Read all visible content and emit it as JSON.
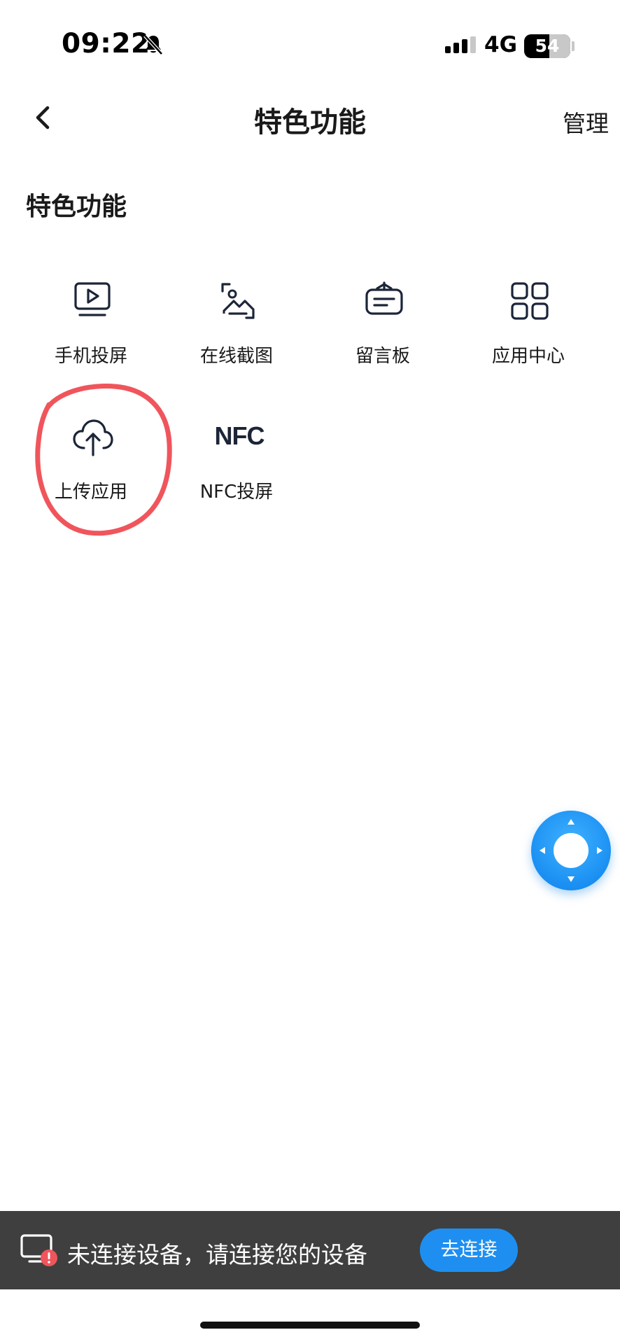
{
  "status_bar": {
    "time": "09:22",
    "network": "4G",
    "battery": "54",
    "icons": [
      "bell-slash-icon",
      "cellular-signal-icon",
      "battery-icon"
    ]
  },
  "header": {
    "back_icon": "chevron-left-icon",
    "title": "特色功能",
    "manage_label": "管理"
  },
  "section": {
    "title": "特色功能"
  },
  "features": [
    {
      "label": "手机投屏",
      "icon": "screen-cast-icon"
    },
    {
      "label": "在线截图",
      "icon": "screenshot-image-icon"
    },
    {
      "label": "留言板",
      "icon": "message-board-icon"
    },
    {
      "label": "应用中心",
      "icon": "app-grid-icon"
    },
    {
      "label": "上传应用",
      "icon": "cloud-upload-icon"
    },
    {
      "label": "NFC投屏",
      "icon": "nfc-icon",
      "icon_text": "NFC"
    }
  ],
  "annotation": {
    "target": "上传应用",
    "color": "#f0555c"
  },
  "remote": {
    "icon": "remote-control-dpad-icon",
    "color": "#1a8ff2"
  },
  "connection_bar": {
    "icon": "device-disconnected-icon",
    "message": "未连接设备，请连接您的设备",
    "button_label": "去连接",
    "button_color": "#1e8ff0"
  },
  "colors": {
    "background": "#ffffff",
    "text": "#1a1a1a",
    "bar_background": "#3f3f3f",
    "alert_red": "#f0555c"
  }
}
